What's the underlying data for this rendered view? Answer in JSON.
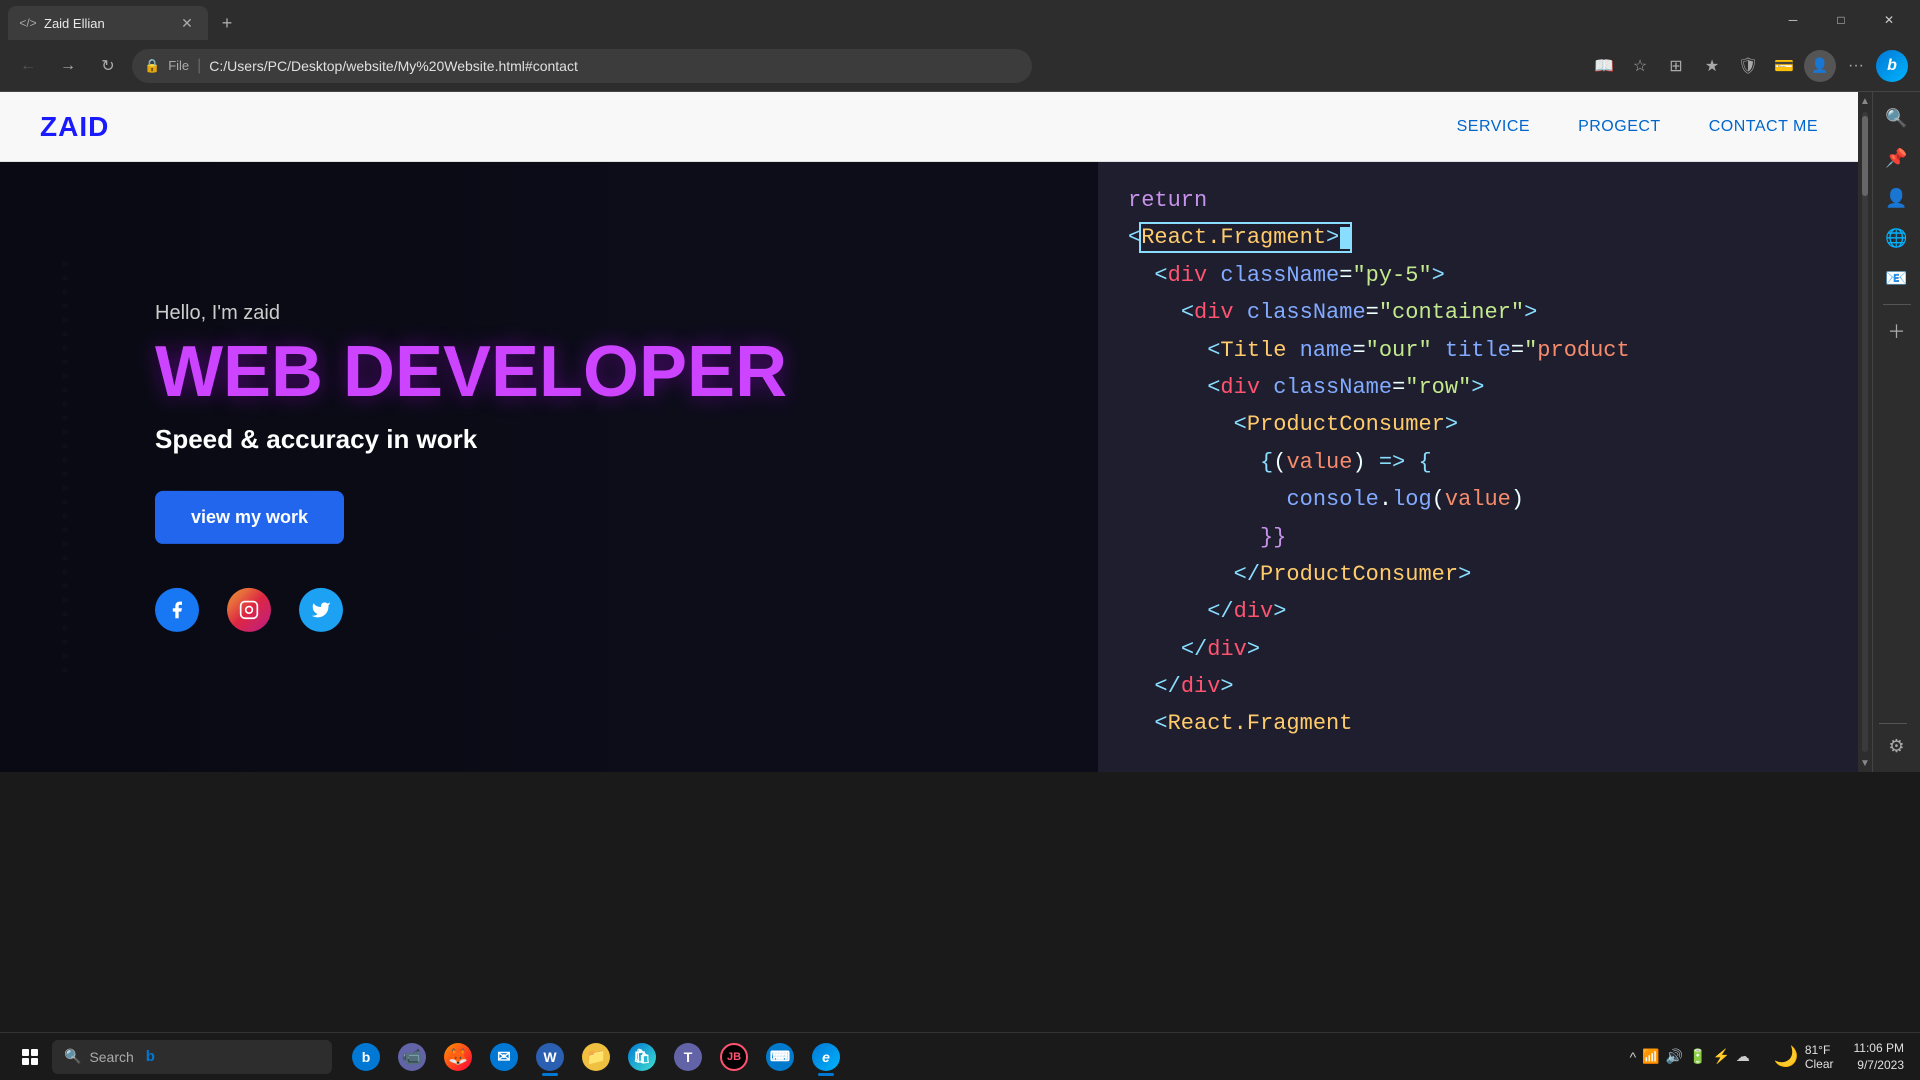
{
  "browser": {
    "tab_title": "Zaid Ellian",
    "tab_icon": "</>",
    "address": "File  |  C:/Users/PC/Desktop/website/My%20Website.html#contact",
    "address_url": "C:/Users/PC/Desktop/website/My%20Website.html#contact"
  },
  "nav": {
    "logo": "ZAID",
    "links": [
      {
        "label": "SERVICE",
        "href": "#service"
      },
      {
        "label": "PROGECT",
        "href": "#project"
      },
      {
        "label": "CONTACT ME",
        "href": "#contact"
      }
    ]
  },
  "hero": {
    "greeting": "Hello, I'm zaid",
    "title": "WEB DEVELOPER",
    "subtitle": "Speed & accuracy in work",
    "cta_label": "view my work",
    "social": [
      {
        "name": "Facebook",
        "icon": "f"
      },
      {
        "name": "Instagram",
        "icon": "📷"
      },
      {
        "name": "Twitter",
        "icon": "🐦"
      }
    ]
  },
  "taskbar": {
    "search_placeholder": "Search",
    "weather_temp": "81°F",
    "weather_condition": "Clear",
    "time": "11:06 PM",
    "date": "9/7/2023"
  },
  "right_sidebar": {
    "icons": [
      "🔍",
      "📌",
      "👤",
      "🌐",
      "⚙"
    ]
  }
}
